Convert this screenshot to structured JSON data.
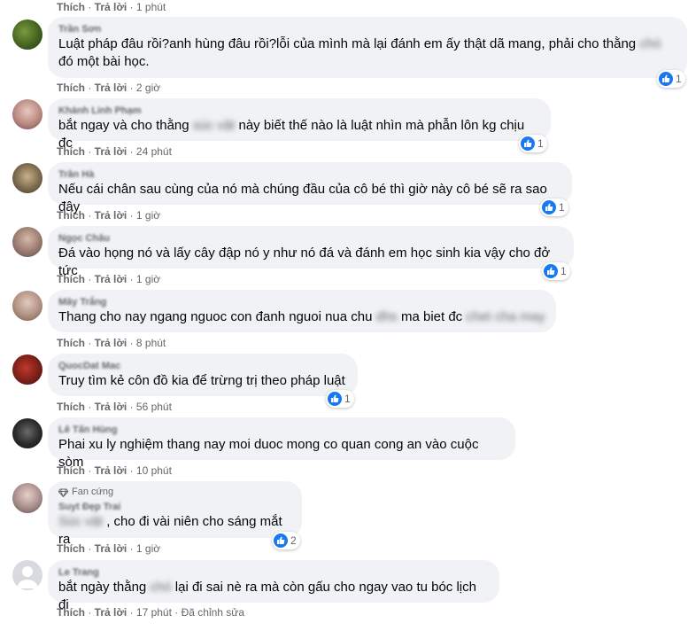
{
  "labels": {
    "like": "Thích",
    "reply": "Trả lời",
    "sep": " · "
  },
  "top_time": "1 phút",
  "comments": [
    {
      "name": "Trần Sơn",
      "text_a": "Luật pháp đâu rồi?anh hùng đâu rồi?lỗi của mình mà lại đánh em ấy thật dã mang, phải cho thằng ",
      "blur": "chó",
      "text_b": " đó một bài học.",
      "reactions": "1",
      "time": "2 giờ"
    },
    {
      "name": "Khánh Linh Phạm",
      "text_a": "bắt ngay và cho thằng ",
      "blur": "súc vật",
      "text_b": " này biết thế nào là luật nhìn mà phẫn lôn kg chịu đc",
      "reactions": "1",
      "time": "24 phút"
    },
    {
      "name": "Trần Hà",
      "text_a": "Nếu cái chân sau cùng của nó mà chúng đầu của cô bé thì giờ này cô bé sẽ ra sao đây",
      "blur": "",
      "text_b": "",
      "reactions": "1",
      "time": "1 giờ"
    },
    {
      "name": "Ngọc Châu",
      "text_a": "Đá vào họng nó và lấy cây đập nó y như nó đá và đánh em học sinh kia vậy cho đở tức",
      "blur": "",
      "text_b": "",
      "reactions": "1",
      "time": "1 giờ"
    },
    {
      "name": "Mây Trắng",
      "text_a": "Thang cho nay ngang nguoc con đanh nguoi nua chu ",
      "blur": "dhs",
      "text_b": " ma biet đc ",
      "blur2": "chet cha may",
      "time": "8 phút"
    },
    {
      "name": "QuocDat Mac",
      "text_a": "Truy tìm kẻ côn đồ kia để trừng trị theo pháp luật",
      "blur": "",
      "text_b": "",
      "reactions": "1",
      "time": "56 phút"
    },
    {
      "name": "Lê Tấn Hùng",
      "text_a": "Phai xu ly nghiệm thang nay moi duoc mong co quan cong an vào cuộc sòm",
      "blur": "",
      "text_b": "",
      "time": "10 phút"
    },
    {
      "badge": "Fan cứng",
      "name": "Suyt Đẹp Trai",
      "text_a": "",
      "blur": "Súc vật",
      "text_b": " , cho đi vài niên cho sáng mắt ra",
      "reactions": "2",
      "time": "1 giờ"
    },
    {
      "name": "Le Trang",
      "text_a": "bắt ngày thằng ",
      "blur": "chó",
      "text_b": " lại đi sai nè ra mà còn gấu cho ngay vao tu bóc lịch đi",
      "time": "17 phút",
      "edited": "Đã chỉnh sửa"
    }
  ],
  "colors": {
    "like_blue": "#1877f2",
    "bubble_bg": "#f0f2f5",
    "meta_gray": "#65676b"
  }
}
